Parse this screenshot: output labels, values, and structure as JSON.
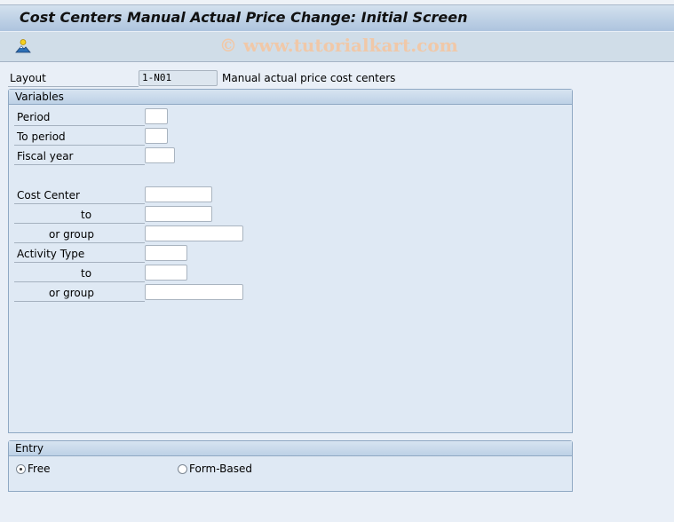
{
  "window": {
    "title": "Cost Centers Manual Actual Price Change: Initial Screen"
  },
  "toolbar": {
    "icons": [
      {
        "name": "mountain-sun-icon",
        "tooltip": ""
      }
    ],
    "watermark": "© www.tutorialkart.com"
  },
  "layout": {
    "label": "Layout",
    "value": "1-N01",
    "description": "Manual actual price cost centers"
  },
  "variables": {
    "header": "Variables",
    "fields": [
      {
        "label": "Period",
        "value": ""
      },
      {
        "label": "To period",
        "value": ""
      },
      {
        "label": "Fiscal year",
        "value": ""
      },
      {
        "label": "Cost Center",
        "value": ""
      },
      {
        "label": "to",
        "value": ""
      },
      {
        "label": "or group",
        "value": ""
      },
      {
        "label": "Activity Type",
        "value": ""
      },
      {
        "label": "to",
        "value": ""
      },
      {
        "label": "or group",
        "value": ""
      }
    ]
  },
  "entry": {
    "header": "Entry",
    "options": [
      {
        "label": "Free",
        "selected": true
      },
      {
        "label": "Form-Based",
        "selected": false
      }
    ]
  }
}
